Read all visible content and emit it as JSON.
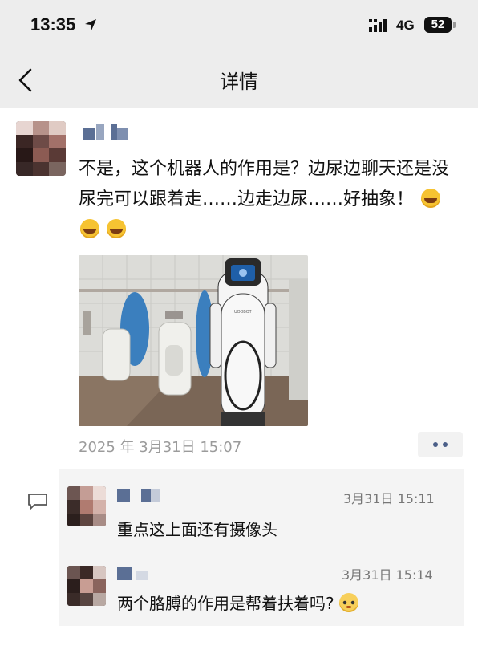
{
  "status_bar": {
    "time": "13:35",
    "network": "4G",
    "battery": "52"
  },
  "nav": {
    "title": "详情"
  },
  "post": {
    "text": "不是，这个机器人的作用是？边尿边聊天还是没尿完可以跟着走……边走边尿……好抽象！",
    "emoji": "face-with-tears-of-joy",
    "timestamp": "2025 年 3月31日 15:07",
    "photo_screen_text": "UOOBOT"
  },
  "comments": [
    {
      "time": "3月31日 15:11",
      "text": "重点这上面还有摄像头"
    },
    {
      "time": "3月31日 15:14",
      "text": "两个胳膊的作用是帮着扶着吗?",
      "emoji": "flushed-face"
    }
  ],
  "colors": {
    "header_bg": "#ededed",
    "name_blue": "#5b6f95",
    "comment_bg": "#f4f4f4",
    "timestamp_gray": "#9b9b9b"
  }
}
